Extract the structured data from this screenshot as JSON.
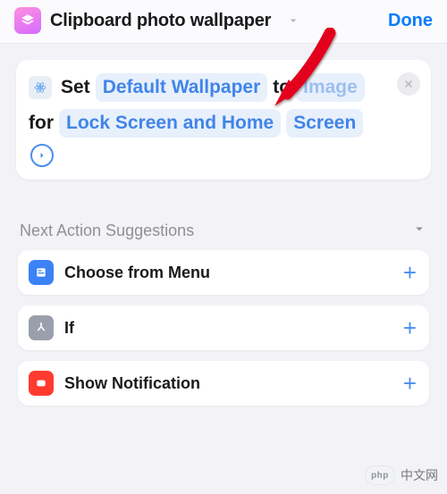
{
  "header": {
    "shortcut_name": "Clipboard photo wallpaper",
    "done": "Done"
  },
  "action": {
    "verb": "Set",
    "wallpaper_token": "Default Wallpaper",
    "connector_to": "to",
    "image_token": "Image",
    "connector_for": "for",
    "scope_token_part1": "Lock Screen and Home",
    "scope_token_part2": "Screen"
  },
  "suggestions": {
    "heading": "Next Action Suggestions",
    "items": [
      {
        "label": "Choose from Menu"
      },
      {
        "label": "If"
      },
      {
        "label": "Show Notification"
      }
    ]
  },
  "watermark": {
    "badge": "php",
    "text": "中文网"
  }
}
